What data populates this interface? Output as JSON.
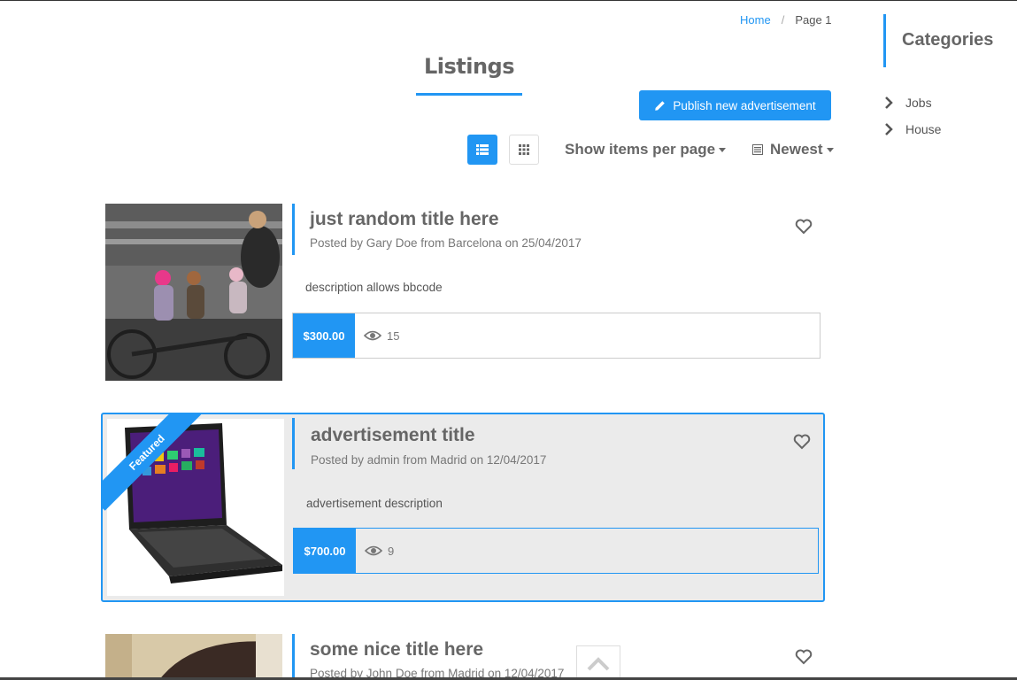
{
  "breadcrumb": {
    "home": "Home",
    "separator": "/",
    "current": "Page 1"
  },
  "page": {
    "title": "Listings"
  },
  "toolbar": {
    "publish_label": "Publish new advertisement",
    "per_page_label": "Show items per page",
    "sort_label": "Newest"
  },
  "sidebar": {
    "heading": "Categories",
    "items": [
      {
        "label": "Jobs"
      },
      {
        "label": "House"
      }
    ]
  },
  "listings": [
    {
      "title": "just random title here",
      "meta": "Posted by Gary Doe from Barcelona on 25/04/2017",
      "description": "description allows bbcode",
      "price": "$300.00",
      "views": "15",
      "featured": false
    },
    {
      "title": "advertisement title",
      "meta": "Posted by admin from Madrid on 12/04/2017",
      "description": "advertisement description",
      "price": "$700.00",
      "views": "9",
      "featured": true,
      "badge": "Featured"
    },
    {
      "title": "some nice title here",
      "meta": "Posted by John Doe from Madrid on 12/04/2017",
      "featured": false
    }
  ],
  "colors": {
    "accent": "#2196f3",
    "text": "#666666",
    "featured_bg": "#ebebeb"
  },
  "icons": [
    "pencil-icon",
    "list-view-icon",
    "grid-view-icon",
    "sort-icon",
    "chevron-right-icon",
    "heart-icon",
    "eye-icon",
    "chevron-up-icon"
  ]
}
